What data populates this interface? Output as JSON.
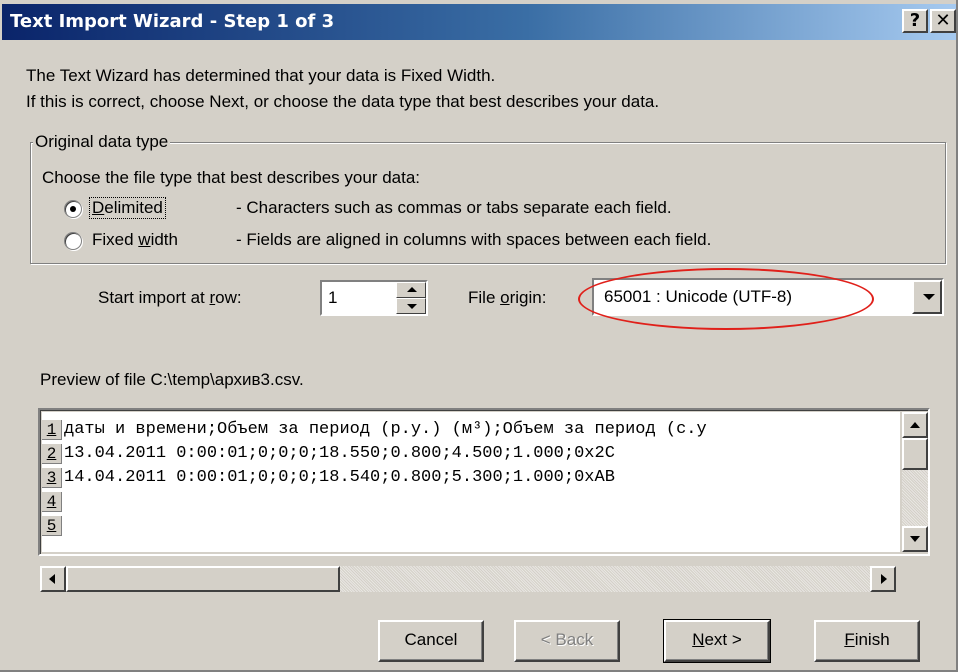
{
  "window": {
    "title": "Text Import Wizard - Step 1 of 3",
    "help_button": "?",
    "close_button": "✕"
  },
  "intro": {
    "line1": "The Text Wizard has determined that your data is Fixed Width.",
    "line2": "If this is correct, choose Next, or choose the data type that best describes your data."
  },
  "data_type": {
    "legend": "Original data type",
    "prompt": "Choose the file type that best describes your data:",
    "options": [
      {
        "label_pre": "",
        "label_key": "D",
        "label_post": "elimited",
        "description": "- Characters such as commas or tabs separate each field.",
        "selected": true
      },
      {
        "label_pre": "Fixed ",
        "label_key": "w",
        "label_post": "idth",
        "description": "- Fields are aligned in columns with spaces between each field.",
        "selected": false
      }
    ]
  },
  "start_row": {
    "label_pre": "Start import at ",
    "label_key": "r",
    "label_post": "ow:",
    "value": "1"
  },
  "file_origin": {
    "label_pre": "File ",
    "label_key": "o",
    "label_post": "rigin:",
    "value": "65001 : Unicode (UTF-8)",
    "highlight_color": "#e0201a"
  },
  "preview": {
    "label": "Preview of file C:\\temp\\архив3.csv.",
    "rows": [
      {
        "num": "1",
        "text": "даты и времени;Объем за период (р.у.) (м³);Объем за период (с.у"
      },
      {
        "num": "2",
        "text": "13.04.2011 0:00:01;0;0;0;18.550;0.800;4.500;1.000;0x2C"
      },
      {
        "num": "3",
        "text": "14.04.2011 0:00:01;0;0;0;18.540;0.800;5.300;1.000;0xAB"
      },
      {
        "num": "4",
        "text": ""
      },
      {
        "num": "5",
        "text": ""
      }
    ]
  },
  "buttons": {
    "cancel": "Cancel",
    "back": "< Back",
    "next_key": "N",
    "next_post": "ext >",
    "finish_key": "F",
    "finish_post": "inish"
  }
}
